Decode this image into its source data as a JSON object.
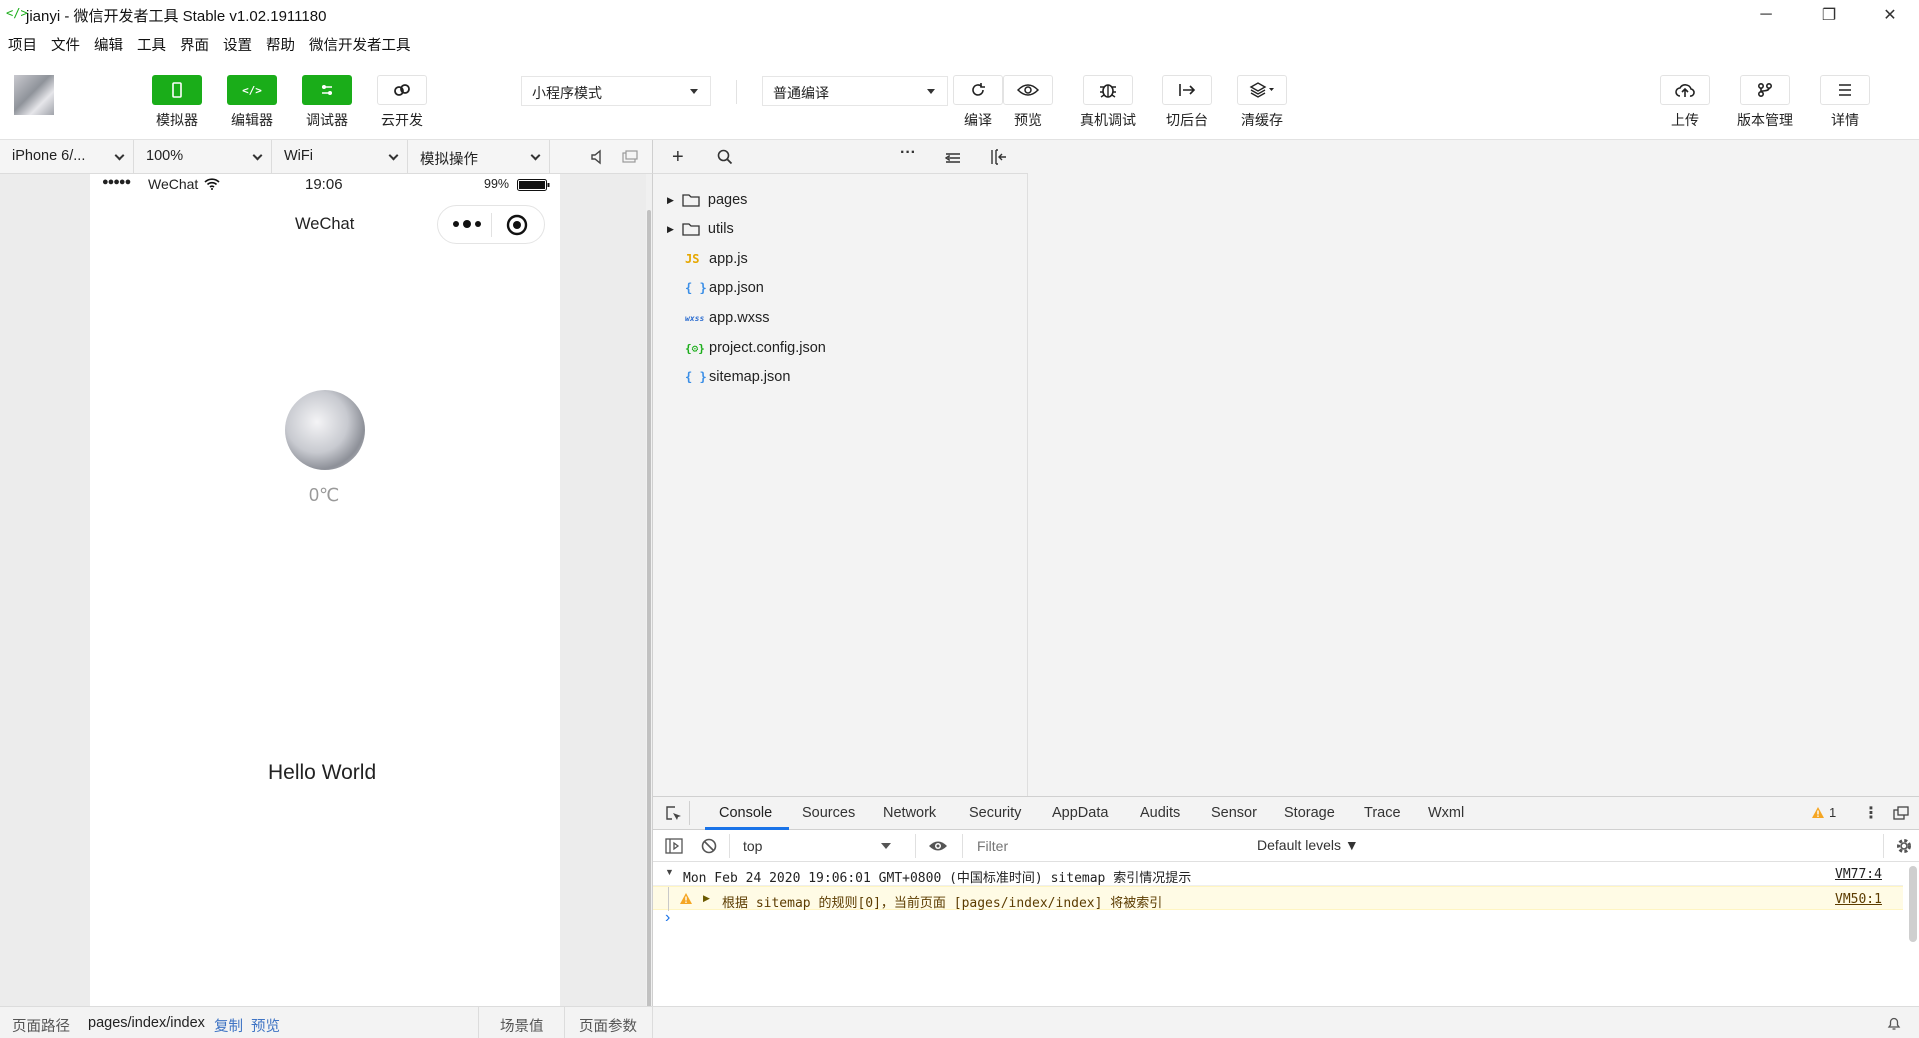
{
  "window": {
    "logo_text": "</>",
    "title": "jianyi - 微信开发者工具 Stable v1.02.1911180",
    "minimize": "─",
    "restore": "❐",
    "close": "✕"
  },
  "menu": [
    "项目",
    "文件",
    "编辑",
    "工具",
    "界面",
    "设置",
    "帮助",
    "微信开发者工具"
  ],
  "toolbar": {
    "simulator": "模拟器",
    "editor": "编辑器",
    "debugger": "调试器",
    "cloud": "云开发",
    "mode_select": "小程序模式",
    "compile_select": "普通编译",
    "compile": "编译",
    "preview": "预览",
    "remote_debug": "真机调试",
    "background": "切后台",
    "clear_cache": "清缓存",
    "upload": "上传",
    "version": "版本管理",
    "details": "详情"
  },
  "simbar": {
    "device": "iPhone 6/...",
    "zoom": "100%",
    "network": "WiFi",
    "operation": "模拟操作"
  },
  "phone": {
    "signal": "●●●●●",
    "carrier": "WeChat",
    "time": "19:06",
    "battery": "99%",
    "nav_title": "WeChat",
    "temperature": "0℃",
    "hello": "Hello World"
  },
  "explorer": {
    "items": [
      {
        "type": "folder",
        "name": "pages"
      },
      {
        "type": "folder",
        "name": "utils"
      },
      {
        "type": "js",
        "icon": "JS",
        "name": "app.js"
      },
      {
        "type": "json",
        "icon": "{ }",
        "name": "app.json"
      },
      {
        "type": "wxss",
        "icon": "wxss",
        "name": "app.wxss"
      },
      {
        "type": "config",
        "icon": "{⚙}",
        "name": "project.config.json"
      },
      {
        "type": "json",
        "icon": "{ }",
        "name": "sitemap.json"
      }
    ]
  },
  "devtools": {
    "tabs": [
      "Console",
      "Sources",
      "Network",
      "Security",
      "AppData",
      "Audits",
      "Sensor",
      "Storage",
      "Trace",
      "Wxml"
    ],
    "warning_count": "1",
    "context": "top",
    "filter_placeholder": "Filter",
    "levels": "Default levels ▼",
    "log_header": "Mon Feb 24 2020 19:06:01 GMT+0800 (中国标准时间) sitemap 索引情况提示",
    "log_header_src": "VM77:4",
    "log_warn": "根据 sitemap 的规则[0]，当前页面 [pages/index/index] 将被索引",
    "log_warn_src": "VM50:1",
    "prompt": "›"
  },
  "status": {
    "path_label": "页面路径",
    "path": "pages/index/index",
    "copy": "复制",
    "preview": "预览",
    "scene": "场景值",
    "params": "页面参数"
  },
  "colors": {
    "brand_green": "#1aad19",
    "warning_yellow": "#f5a623",
    "link_blue": "#3f74c4"
  }
}
